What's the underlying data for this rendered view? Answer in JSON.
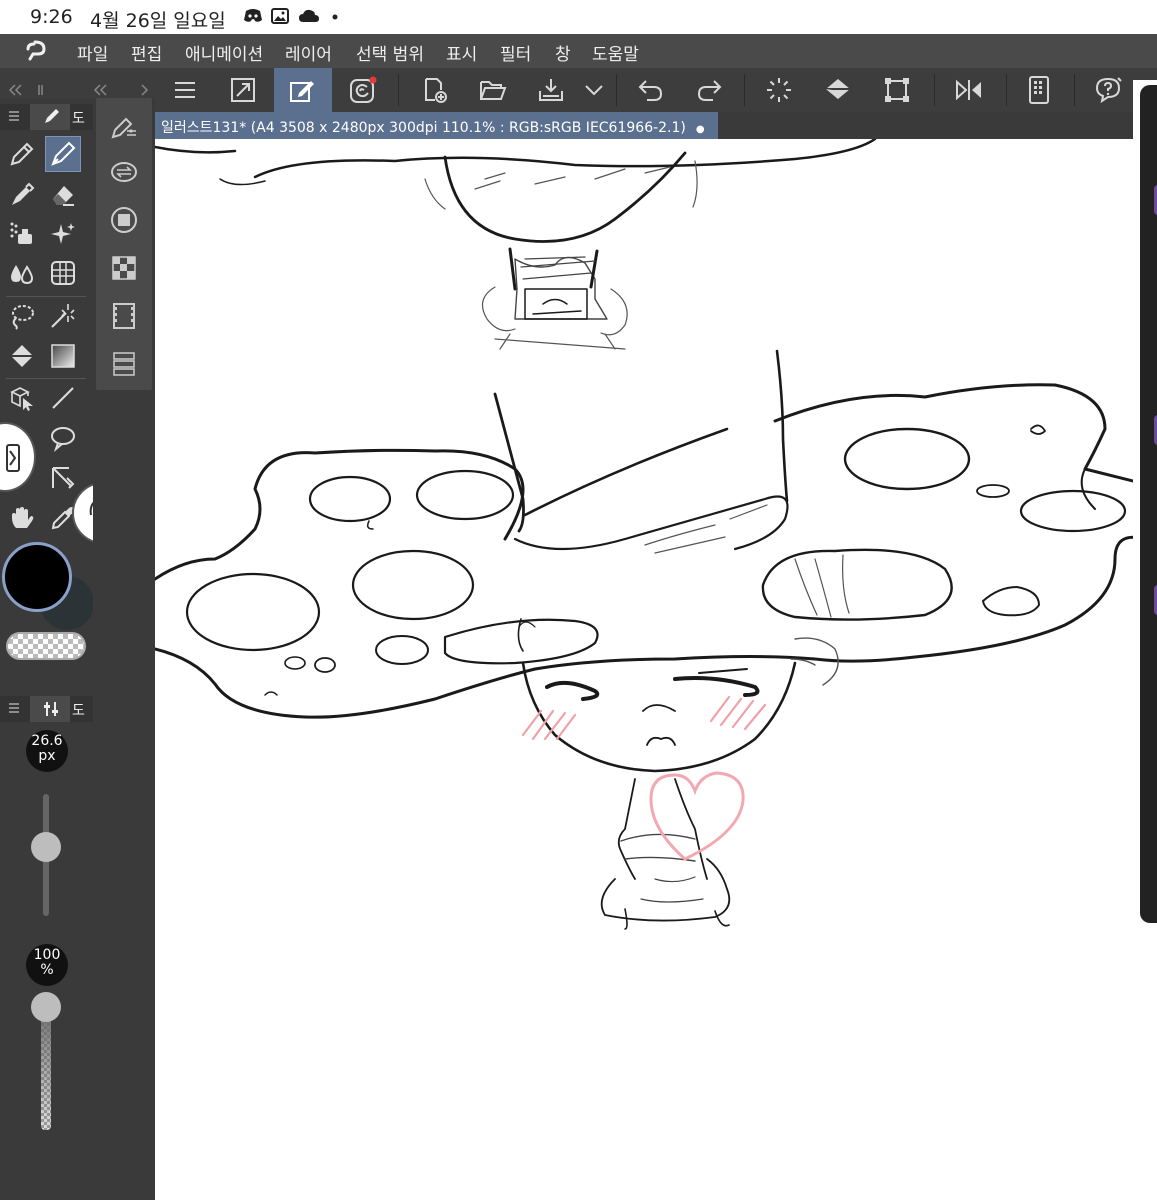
{
  "status_bar": {
    "time": "9:26",
    "date": "4월 26일 일요일",
    "icons": [
      "discord-icon",
      "gallery-icon",
      "cloud-icon",
      "dot-icon"
    ]
  },
  "menu": {
    "items": [
      "파일",
      "편집",
      "애니메이션",
      "레이어",
      "선택 범위",
      "표시",
      "필터",
      "창",
      "도움말"
    ]
  },
  "toolbar": {
    "icons": [
      "menu-icon",
      "fit-canvas-icon",
      "edit-mode-icon",
      "clip-studio-icon",
      "new-file-icon",
      "open-file-icon",
      "save-icon",
      "dropdown-icon",
      "undo-icon",
      "redo-icon",
      "loading-icon",
      "fill-icon",
      "transform-icon",
      "flip-icon",
      "device-icon",
      "help-icon"
    ]
  },
  "document": {
    "tab_title": "일러스트131* (A4 3508 x 2480px 300dpi 110.1% : RGB:sRGB IEC61966-2.1)",
    "tab_dot": "●"
  },
  "tool_panel": {
    "header_label": "도",
    "tools": [
      "pen-icon",
      "pencil-icon",
      "marker-icon",
      "eraser-icon",
      "airbrush-icon",
      "sparkle-icon",
      "blend-icon",
      "grid-icon",
      "lasso-icon",
      "magic-wand-icon",
      "fill-bucket-icon",
      "gradient-icon",
      "object-select-icon",
      "line-icon",
      "balloon-icon",
      "ruler-icon",
      "hand-icon",
      "eyedropper-icon"
    ],
    "active_tool": "pencil-icon"
  },
  "subtool_panel": {
    "icons": [
      "brush-settings-icon",
      "swap-icon",
      "layer-property-icon",
      "palette-icon",
      "animation-icon",
      "layers-icon"
    ]
  },
  "colors": {
    "main": "#000000",
    "sub": "#2c3336",
    "accent": "#5b6f8f",
    "highlight_red": "#e23b3b"
  },
  "brush_panel": {
    "header_label": "도",
    "size_value": "26.6",
    "size_unit": "px",
    "opacity_value": "100",
    "opacity_unit": "%"
  }
}
